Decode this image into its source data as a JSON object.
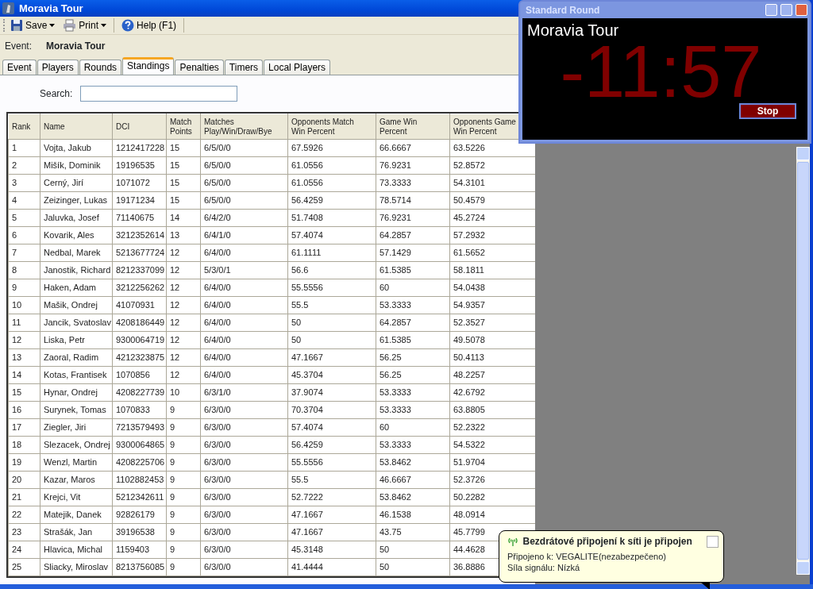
{
  "window": {
    "title": "Moravia Tour"
  },
  "toolbar": [
    {
      "label": "Save",
      "kind": "save",
      "dropdown": true
    },
    {
      "label": "Print",
      "kind": "print",
      "dropdown": true
    },
    {
      "label": "Help (F1)",
      "kind": "help",
      "dropdown": false
    }
  ],
  "event": {
    "label": "Event:",
    "value": "Moravia Tour"
  },
  "tabs": [
    {
      "label": "Event",
      "selected": false
    },
    {
      "label": "Players",
      "selected": false
    },
    {
      "label": "Rounds",
      "selected": false
    },
    {
      "label": "Standings",
      "selected": true
    },
    {
      "label": "Penalties",
      "selected": false
    },
    {
      "label": "Timers",
      "selected": false
    },
    {
      "label": "Local Players",
      "selected": false
    }
  ],
  "search": {
    "label": "Search:"
  },
  "table": {
    "columns": [
      {
        "lines": [
          "Rank"
        ]
      },
      {
        "lines": [
          "Name"
        ]
      },
      {
        "lines": [
          "DCI"
        ]
      },
      {
        "lines": [
          "Match",
          "Points"
        ]
      },
      {
        "lines": [
          "Matches",
          "Play/Win/Draw/Bye"
        ]
      },
      {
        "lines": [
          "Opponents Match",
          "Win Percent"
        ]
      },
      {
        "lines": [
          "Game Win",
          "Percent"
        ]
      },
      {
        "lines": [
          "Opponents Game",
          "Win Percent"
        ]
      }
    ],
    "rows": [
      [
        "1",
        "Vojta, Jakub",
        "1212417228",
        "15",
        "6/5/0/0",
        "67.5926",
        "66.6667",
        "63.5226"
      ],
      [
        "2",
        "Mišík, Dominik",
        "19196535",
        "15",
        "6/5/0/0",
        "61.0556",
        "76.9231",
        "52.8572"
      ],
      [
        "3",
        "Cerný, Jirí",
        "1071072",
        "15",
        "6/5/0/0",
        "61.0556",
        "73.3333",
        "54.3101"
      ],
      [
        "4",
        "Zeizinger, Lukas",
        "19171234",
        "15",
        "6/5/0/0",
        "56.4259",
        "78.5714",
        "50.4579"
      ],
      [
        "5",
        "Jaluvka, Josef",
        "71140675",
        "14",
        "6/4/2/0",
        "51.7408",
        "76.9231",
        "45.2724"
      ],
      [
        "6",
        "Kovarik, Ales",
        "3212352614",
        "13",
        "6/4/1/0",
        "57.4074",
        "64.2857",
        "57.2932"
      ],
      [
        "7",
        "Nedbal, Marek",
        "5213677724",
        "12",
        "6/4/0/0",
        "61.1111",
        "57.1429",
        "61.5652"
      ],
      [
        "8",
        "Janostik, Richard",
        "8212337099",
        "12",
        "5/3/0/1",
        "56.6",
        "61.5385",
        "58.1811"
      ],
      [
        "9",
        "Haken, Adam",
        "3212256262",
        "12",
        "6/4/0/0",
        "55.5556",
        "60",
        "54.0438"
      ],
      [
        "10",
        "Mašik, Ondrej",
        "41070931",
        "12",
        "6/4/0/0",
        "55.5",
        "53.3333",
        "54.9357"
      ],
      [
        "11",
        "Jancik, Svatoslav",
        "4208186449",
        "12",
        "6/4/0/0",
        "50",
        "64.2857",
        "52.3527"
      ],
      [
        "12",
        "Liska, Petr",
        "9300064719",
        "12",
        "6/4/0/0",
        "50",
        "61.5385",
        "49.5078"
      ],
      [
        "13",
        "Zaoral, Radim",
        "4212323875",
        "12",
        "6/4/0/0",
        "47.1667",
        "56.25",
        "50.4113"
      ],
      [
        "14",
        "Kotas, Frantisek",
        "1070856",
        "12",
        "6/4/0/0",
        "45.3704",
        "56.25",
        "48.2257"
      ],
      [
        "15",
        "Hynar, Ondrej",
        "4208227739",
        "10",
        "6/3/1/0",
        "37.9074",
        "53.3333",
        "42.6792"
      ],
      [
        "16",
        "Surynek, Tomas",
        "1070833",
        "9",
        "6/3/0/0",
        "70.3704",
        "53.3333",
        "63.8805"
      ],
      [
        "17",
        "Ziegler, Jiri",
        "7213579493",
        "9",
        "6/3/0/0",
        "57.4074",
        "60",
        "52.2322"
      ],
      [
        "18",
        "Slezacek, Ondrej",
        "9300064865",
        "9",
        "6/3/0/0",
        "56.4259",
        "53.3333",
        "54.5322"
      ],
      [
        "19",
        "Wenzl, Martin",
        "4208225706",
        "9",
        "6/3/0/0",
        "55.5556",
        "53.8462",
        "51.9704"
      ],
      [
        "20",
        "Kazar, Maros",
        "1102882453",
        "9",
        "6/3/0/0",
        "55.5",
        "46.6667",
        "52.3726"
      ],
      [
        "21",
        "Krejci, Vit",
        "5212342611",
        "9",
        "6/3/0/0",
        "52.7222",
        "53.8462",
        "50.2282"
      ],
      [
        "22",
        "Matejik, Danek",
        "92826179",
        "9",
        "6/3/0/0",
        "47.1667",
        "46.1538",
        "48.0914"
      ],
      [
        "23",
        "Strašák, Jan",
        "39196538",
        "9",
        "6/3/0/0",
        "47.1667",
        "43.75",
        "45.7799"
      ],
      [
        "24",
        "Hlavica, Michal",
        "1159403",
        "9",
        "6/3/0/0",
        "45.3148",
        "50",
        "44.4628"
      ],
      [
        "25",
        "Sliacky, Miroslav",
        "8213756085",
        "9",
        "6/3/0/0",
        "41.4444",
        "50",
        "36.8886"
      ]
    ]
  },
  "timer_window": {
    "title": "Standard Round",
    "event": "Moravia Tour",
    "time": "-11:57",
    "button": "Stop"
  },
  "notification": {
    "title": "Bezdrátové připojení k síti je připojen",
    "lines": [
      "Připojeno k: VEGALITE(nezabezpečeno)",
      "Síla signálu: Nízká"
    ]
  }
}
